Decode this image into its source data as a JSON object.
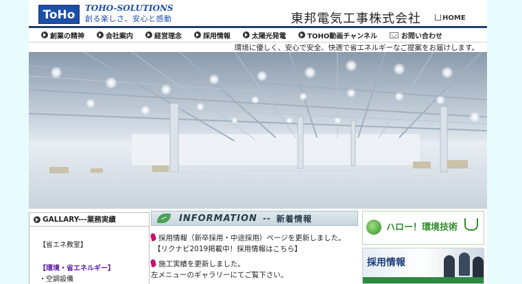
{
  "header": {
    "logo": "ToHo",
    "brand": "TOHO-SOLUTIONS",
    "tagline": "創る楽しさ、安心と感動",
    "company": "東邦電気工事株式会社",
    "home_label": "HOME"
  },
  "nav": {
    "items": [
      {
        "label": "創業の精神"
      },
      {
        "label": "会社案内"
      },
      {
        "label": "経営理念"
      },
      {
        "label": "採用情報"
      },
      {
        "label": "太陽光発電"
      },
      {
        "label": "TOHO動画チャンネル"
      },
      {
        "label": "お問い合わせ"
      }
    ]
  },
  "subline": "環境に優しく、安心で安全、快適で省エネルギーなご提案をお届けします。",
  "left": {
    "heading": "GALLARY---業務実績",
    "items": [
      {
        "label": "【省エネ教室】"
      },
      {
        "label": "【環境・省エネルギー】"
      },
      {
        "label": "・空調設備"
      }
    ]
  },
  "info": {
    "title": "INFORMATION",
    "separator": "--",
    "subtitle": "新着情報",
    "news": [
      {
        "line1": "採用情報（新卒採用・中途採用）ページを更新しました。",
        "line2": "【リクナビ2019掲載中！採用情報はこちら】"
      },
      {
        "line1": "施工実績を更新しました。",
        "line2": "左メニューのギャラリーにてご覧下さい。"
      }
    ]
  },
  "banners": {
    "banner1": "ハロー！環境技術",
    "banner2": "採用情報"
  },
  "colors": {
    "brand_blue": "#1d4fa8",
    "nav_border": "#1a3d6b",
    "accent_magenta": "#c0146d",
    "eco_green": "#2f8a2a"
  }
}
